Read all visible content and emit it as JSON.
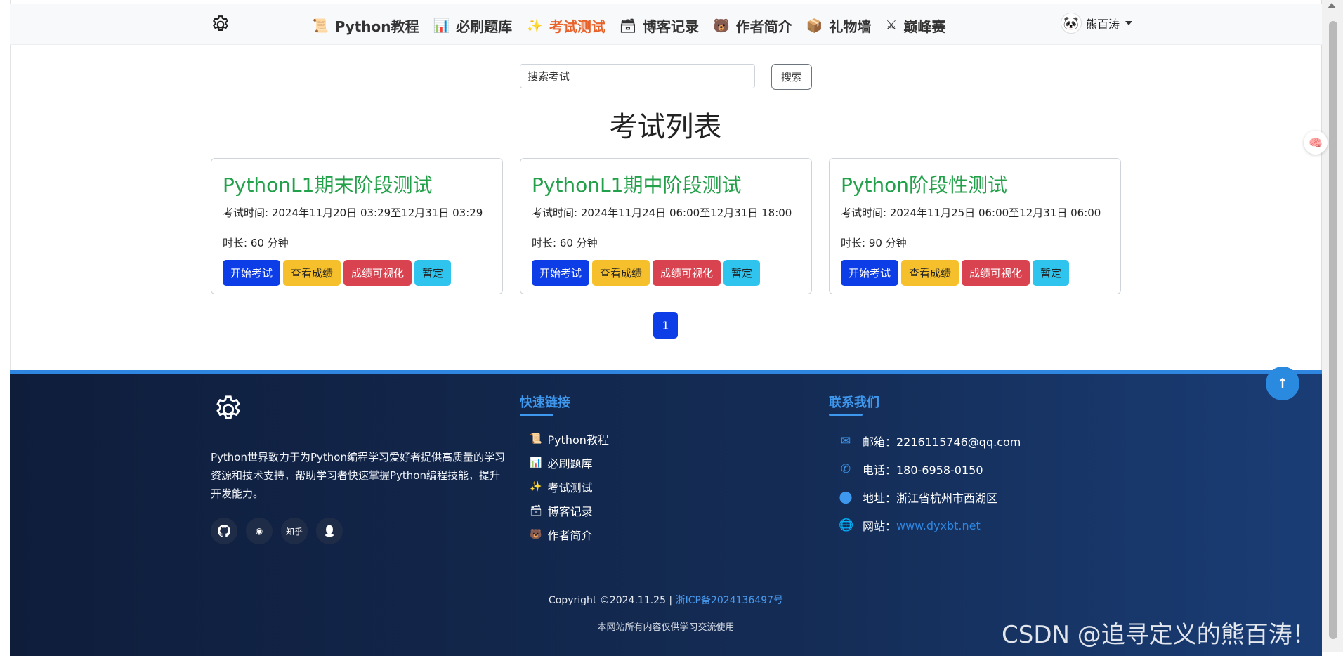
{
  "nav": {
    "items": [
      {
        "label": "Python教程",
        "icon": "📜",
        "active": false
      },
      {
        "label": "必刷题库",
        "icon": "📊",
        "active": false
      },
      {
        "label": "考试测试",
        "icon": "✨",
        "active": true
      },
      {
        "label": "博客记录",
        "icon": "🗃",
        "active": false
      },
      {
        "label": "作者简介",
        "icon": "🐻",
        "active": false
      },
      {
        "label": "礼物墙",
        "icon": "📦",
        "active": false
      },
      {
        "label": "巅峰赛",
        "icon": "⚔",
        "active": false
      }
    ],
    "user_name": "熊百涛"
  },
  "search": {
    "value": "搜索考试",
    "button_label": "搜索"
  },
  "page_title": "考试列表",
  "exams": [
    {
      "title": "PythonL1期末阶段测试",
      "time": "考试时间: 2024年11月20日 03:29至12月31日 03:29",
      "duration": "时长: 60 分钟"
    },
    {
      "title": "PythonL1期中阶段测试",
      "time": "考试时间: 2024年11月24日 06:00至12月31日 18:00",
      "duration": "时长: 60 分钟"
    },
    {
      "title": "Python阶段性测试",
      "time": "考试时间: 2024年11月25日 06:00至12月31日 06:00",
      "duration": "时长: 90 分钟"
    }
  ],
  "exam_buttons": {
    "start": "开始考试",
    "scores": "查看成绩",
    "visualize": "成绩可视化",
    "pause": "暂定"
  },
  "pagination": {
    "current": "1"
  },
  "footer": {
    "about": "Python世界致力于为Python编程学习爱好者提供高质量的学习资源和技术支持，帮助学习者快速掌握Python编程技能，提升开发能力。",
    "social_zhihu": "知乎",
    "quick_links_title": "快速链接",
    "quick_links": [
      "Python教程",
      "必刷题库",
      "考试测试",
      "博客记录",
      "作者简介"
    ],
    "contact_title": "联系我们",
    "email": "邮箱：2216115746@qq.com",
    "phone": "电话：180-6958-0150",
    "address": "地址：浙江省杭州市西湖区",
    "website_label": "网站：",
    "website": "www.dyxbt.net",
    "copyright": "Copyright ©2024.11.25  |  ",
    "icp": "浙ICP备2024136497号",
    "notice": "本网站所有内容仅供学习交流使用"
  },
  "watermark": "CSDN @追寻定义的熊百涛！",
  "colors": {
    "primary": "#0d3de6",
    "warning": "#f5c02b",
    "danger": "#d9424f",
    "info": "#2ec4ed",
    "title_green": "#23a14a",
    "active_nav": "#e8632b",
    "footer_bg": "#0f1d3b"
  }
}
